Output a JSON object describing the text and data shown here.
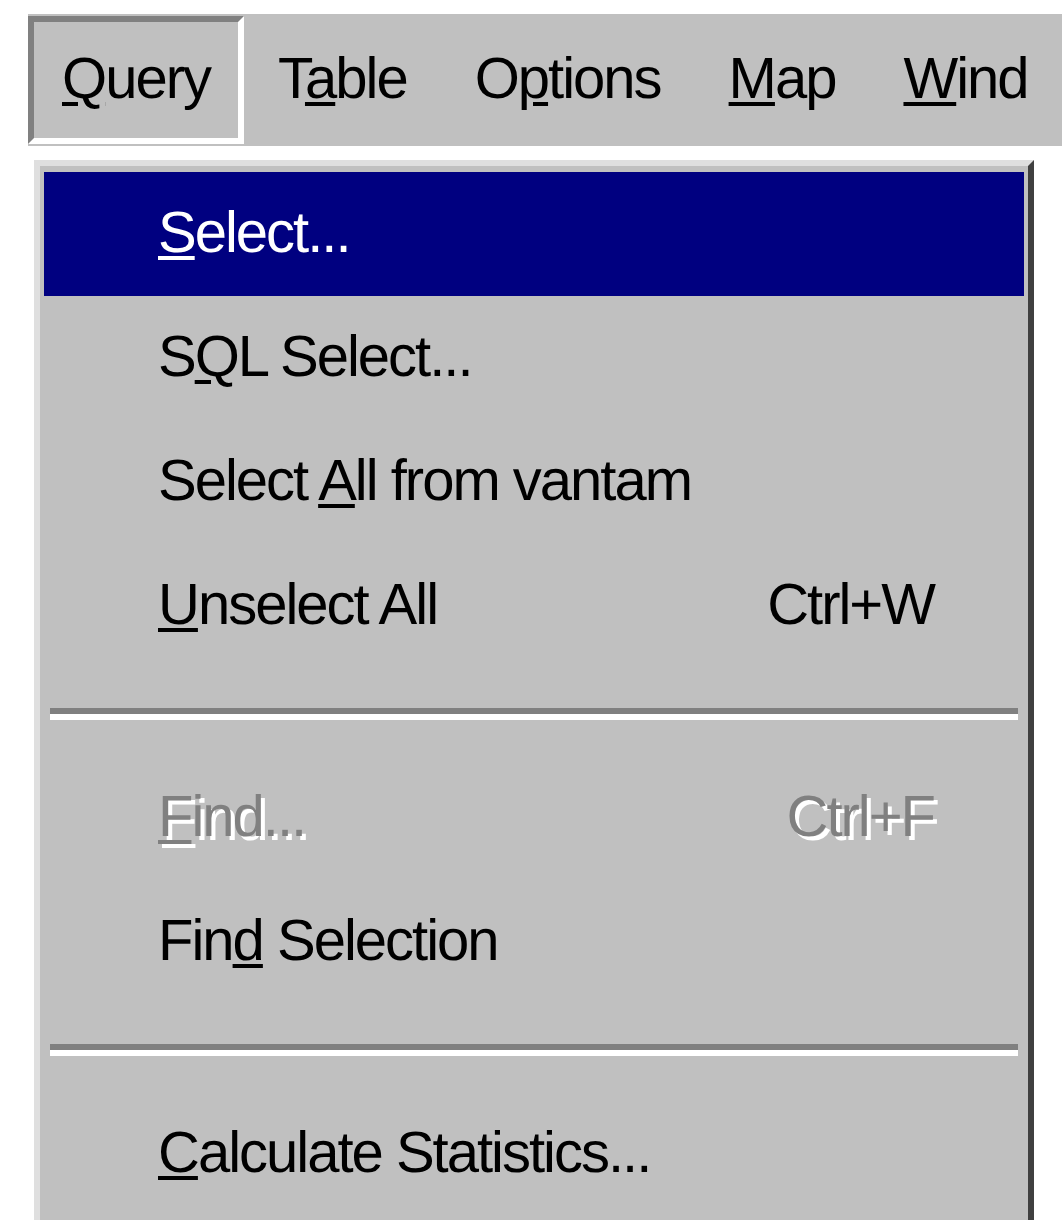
{
  "menubar": [
    {
      "label": {
        "key": "Q",
        "post": "uery"
      },
      "selected": true
    },
    {
      "label": {
        "pre": "T",
        "key": "a",
        "post": "ble"
      },
      "selected": false
    },
    {
      "label": {
        "pre": "O",
        "key": "p",
        "post": "tions"
      },
      "selected": false
    },
    {
      "label": {
        "key": "M",
        "post": "ap"
      },
      "selected": false
    },
    {
      "label": {
        "key": "W",
        "post": "ind"
      },
      "selected": false
    }
  ],
  "menu": [
    {
      "kind": "item",
      "label": {
        "key": "S",
        "post": "elect..."
      },
      "selected": true,
      "disabled": false
    },
    {
      "kind": "item",
      "label": {
        "pre": "S",
        "key": "Q",
        "post": "L Select..."
      },
      "selected": false,
      "disabled": false
    },
    {
      "kind": "item",
      "label": {
        "pre": "Select ",
        "key": "A",
        "post": "ll from vantam"
      },
      "selected": false,
      "disabled": false
    },
    {
      "kind": "item",
      "label": {
        "key": "U",
        "post": "nselect All"
      },
      "shortcut": "Ctrl+W",
      "selected": false,
      "disabled": false
    },
    {
      "kind": "separator"
    },
    {
      "kind": "item",
      "label": {
        "key": "F",
        "post": "ind..."
      },
      "shortcut": "Ctrl+F",
      "selected": false,
      "disabled": true
    },
    {
      "kind": "item",
      "label": {
        "pre": "Fin",
        "key": "d",
        "post": " Selection"
      },
      "selected": false,
      "disabled": false
    },
    {
      "kind": "separator"
    },
    {
      "kind": "item",
      "label": {
        "key": "C",
        "post": "alculate Statistics..."
      },
      "selected": false,
      "disabled": false
    }
  ]
}
